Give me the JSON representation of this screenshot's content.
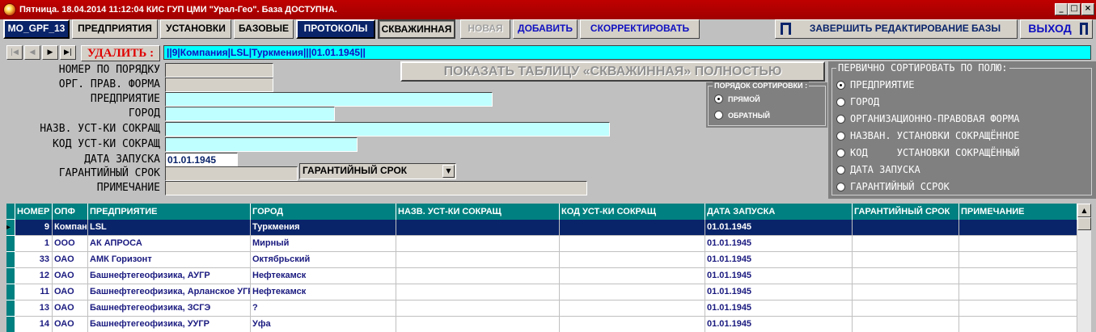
{
  "title": "Пятница. 18.04.2014 11:12:04  КИС ГУП ЦМИ \"Урал-Гео\". База ДОСТУПНА.",
  "window_buttons": {
    "min": "_",
    "max": "□",
    "close": "×"
  },
  "toolbar": {
    "db": "MO_GPF_13",
    "enterprises": "ПРЕДПРИЯТИЯ",
    "installations": "УСТАНОВКИ",
    "bases": "БАЗОВЫЕ",
    "protocols": "ПРОТОКОЛЫ",
    "well": "СКВАЖИННАЯ",
    "new": "НОВАЯ",
    "add": "ДОБАВИТЬ",
    "edit": "СКОРРЕКТИРОВАТЬ",
    "finish": "ЗАВЕРШИТЬ РЕДАКТИРОВАНИЕ БАЗЫ",
    "exit": "ВЫХОД"
  },
  "nav": {
    "first": "|◀",
    "prev": "◀",
    "next": "▶",
    "last": "▶|",
    "delete": "УДАЛИТЬ :",
    "record": "||9|Компания|LSL|Туркмения|||01.01.1945||"
  },
  "form": {
    "labels": {
      "num": "НОМЕР ПО ПОРЯДКУ",
      "org": "ОРГ. ПРАВ. ФОРМА",
      "enterprise": "ПРЕДПРИЯТИЕ",
      "city": "ГОРОД",
      "inst_name": "НАЗВ. УСТ-КИ СОКРАЩ",
      "inst_code": "КОД   УСТ-КИ СОКРАЩ",
      "start_date": "ДАТА ЗАПУСКА",
      "warranty": "ГАРАНТИЙНЫЙ СРОК",
      "note": "ПРИМЕЧАНИЕ"
    },
    "start_date_value": "01.01.1945",
    "warranty_select": "ГАРАНТИЙНЫЙ СРОК",
    "show_table": "ПОКАЗАТЬ ТАБЛИЦУ «СКВАЖИННАЯ» ПОЛНОСТЬЮ"
  },
  "sort_order": {
    "title": "ПОРЯДОК СОРТИРОВКИ :",
    "options": [
      "ПРЯМОЙ",
      "ОБРАТНЫЙ"
    ],
    "selected": 0
  },
  "sort_field": {
    "title": "ПЕРВИЧНО СОРТИРОВАТЬ ПО ПОЛЮ:",
    "options": [
      "ПРЕДПРИЯТИЕ",
      "ГОРОД",
      "ОРГАНИЗАЦИОННО-ПРАВОВАЯ ФОРМА",
      "НАЗВАН. УСТАНОВКИ СОКРАЩЁННОЕ",
      "КОД     УСТАНОВКИ СОКРАЩЁННЫЙ",
      "ДАТА ЗАПУСКА",
      "ГАРАНТИЙНЫЙ ССРОК"
    ],
    "selected": 0
  },
  "grid": {
    "headers": [
      "НОМЕР",
      "ОПФ",
      "ПРЕДПРИЯТИЕ",
      "ГОРОД",
      "НАЗВ. УСТ-КИ СОКРАЩ",
      "КОД УСТ-КИ СОКРАЩ",
      "ДАТА ЗАПУСКА",
      "ГАРАНТИЙНЫЙ СРОК",
      "ПРИМЕЧАНИЕ"
    ],
    "rows": [
      [
        "9",
        "Компания",
        "LSL",
        "Туркмения",
        "",
        "",
        "01.01.1945",
        "",
        ""
      ],
      [
        "1",
        "ООО",
        "АК АПРОСА",
        "Мирный",
        "",
        "",
        "01.01.1945",
        "",
        ""
      ],
      [
        "33",
        "ОАО",
        "АМК Горизонт",
        "Октябрьский",
        "",
        "",
        "01.01.1945",
        "",
        ""
      ],
      [
        "12",
        "ОАО",
        "Башнефтегеофизика, АУГР",
        "Нефтекамск",
        "",
        "",
        "01.01.1945",
        "",
        ""
      ],
      [
        "11",
        "ОАО",
        "Башнефтегеофизика, Арланское УГР",
        "Нефтекамск",
        "",
        "",
        "01.01.1945",
        "",
        ""
      ],
      [
        "13",
        "ОАО",
        "Башнефтегеофизика, ЗСГЭ",
        "?",
        "",
        "",
        "01.01.1945",
        "",
        ""
      ],
      [
        "14",
        "ОАО",
        "Башнефтегеофизика, УУГР",
        "Уфа",
        "",
        "",
        "01.01.1945",
        "",
        ""
      ]
    ],
    "selected_row": 0
  },
  "colors": {
    "accent": "#0a246a",
    "field_cyan": "#c0ffff",
    "record_bar": "#00ffff",
    "grid_header": "#008080",
    "title_red": "#b00000"
  }
}
